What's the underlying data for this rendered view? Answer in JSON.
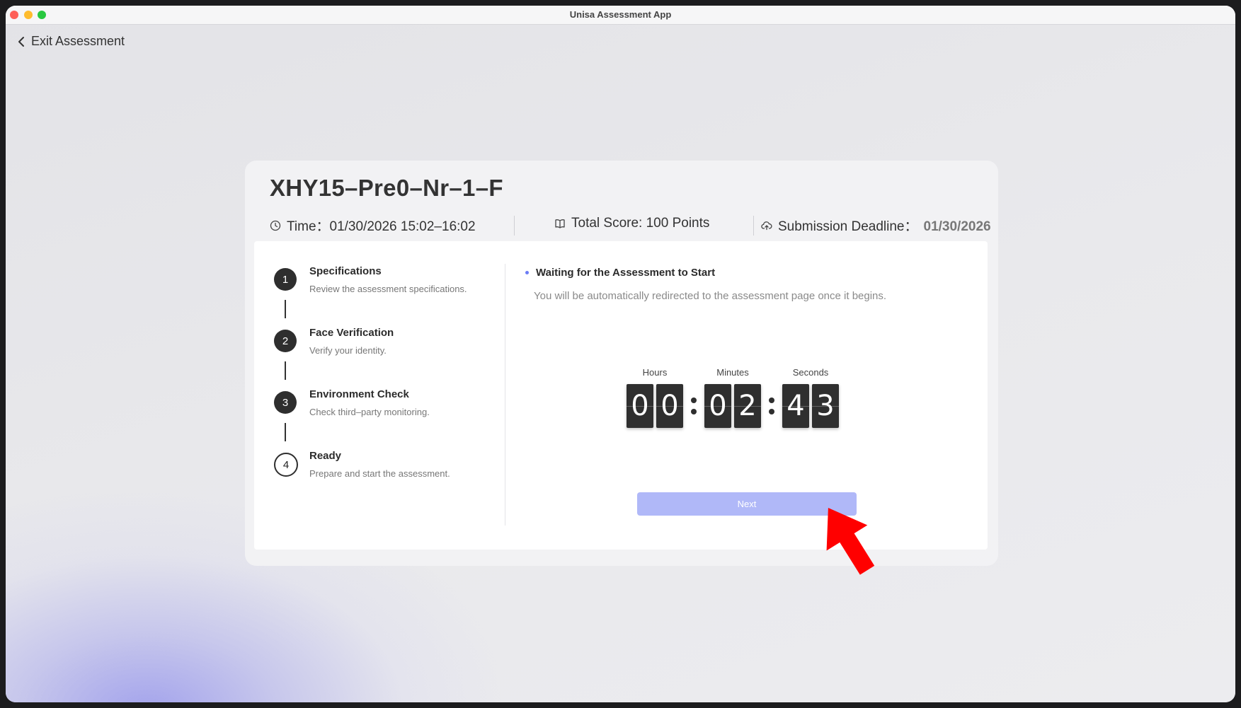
{
  "window": {
    "title": "Unisa Assessment App"
  },
  "nav": {
    "exit_label": "Exit Assessment"
  },
  "assessment": {
    "title": "XHY15–Pre0–Nr–1–F",
    "time_label": "Time：01/30/2026 15:02–16:02",
    "score_label": "Total Score: 100 Points",
    "deadline_label": "Submission Deadline：",
    "deadline_value": "01/30/2026"
  },
  "steps": [
    {
      "number": "1",
      "title": "Specifications",
      "description": "Review the assessment specifications."
    },
    {
      "number": "2",
      "title": "Face Verification",
      "description": "Verify your identity."
    },
    {
      "number": "3",
      "title": "Environment Check",
      "description": "Check third–party monitoring."
    },
    {
      "number": "4",
      "title": "Ready",
      "description": "Prepare and start the assessment."
    }
  ],
  "status": {
    "heading": "Waiting for the Assessment to Start",
    "message": "You will be automatically redirected to the assessment page once it begins."
  },
  "countdown": {
    "hours_label": "Hours",
    "minutes_label": "Minutes",
    "seconds_label": "Seconds",
    "hours": [
      "0",
      "0"
    ],
    "minutes": [
      "0",
      "2"
    ],
    "seconds": [
      "4",
      "3"
    ]
  },
  "actions": {
    "next_label": "Next"
  },
  "colors": {
    "accent_dot": "#6b7cf5",
    "next_button": "#b0b8f8",
    "annotation_arrow": "#ff0000"
  }
}
